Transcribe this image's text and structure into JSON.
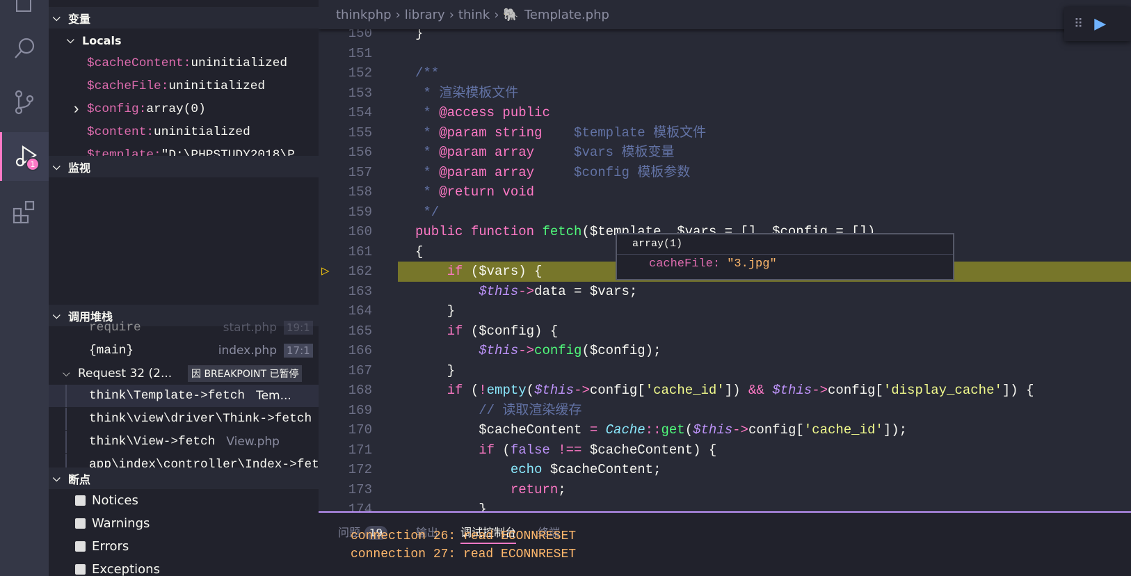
{
  "activity_bar": {
    "items": [
      "explorer-icon",
      "search-icon",
      "source-control-icon",
      "run-debug-icon",
      "extensions-icon"
    ],
    "debug_badge": "1"
  },
  "sidebar": {
    "variables": {
      "title": "变量",
      "locals_label": "Locals",
      "items": [
        {
          "name": "$cacheContent:",
          "value": "uninitialized",
          "expandable": false
        },
        {
          "name": "$cacheFile:",
          "value": "uninitialized",
          "expandable": false
        },
        {
          "name": "$config:",
          "value": "array(0)",
          "expandable": true
        },
        {
          "name": "$content:",
          "value": "uninitialized",
          "expandable": false
        },
        {
          "name": "$template:",
          "value": "\"D:\\PHPSTUDY2018\\P",
          "expandable": false
        }
      ]
    },
    "watch": {
      "title": "监视"
    },
    "call_stack": {
      "title": "调用堆栈",
      "frames_top": [
        {
          "name": "require",
          "file": "start.php",
          "pos": "19:1"
        },
        {
          "name": "{main}",
          "file": "index.php",
          "pos": "17:1"
        }
      ],
      "request": {
        "label": "Request 32 (2...",
        "status": "因 BREAKPOINT 已暂停"
      },
      "frames": [
        {
          "name": "think\\Template->fetch",
          "file": "Tem..."
        },
        {
          "name": "think\\view\\driver\\Think->fetch",
          "file": ""
        },
        {
          "name": "think\\View->fetch",
          "file": "View.php"
        },
        {
          "name": "app\\index\\controller\\Index->fet",
          "file": ""
        }
      ]
    },
    "breakpoints": {
      "title": "断点",
      "items": [
        {
          "label": "Notices",
          "checked": false
        },
        {
          "label": "Warnings",
          "checked": false
        },
        {
          "label": "Errors",
          "checked": false
        },
        {
          "label": "Exceptions",
          "checked": false
        }
      ]
    }
  },
  "editor": {
    "breadcrumb": [
      "thinkphp",
      "library",
      "think",
      "Template.php"
    ],
    "current_line": 162,
    "lines": [
      {
        "n": "150",
        "t": [
          [
            "tx",
            "}"
          ]
        ]
      },
      {
        "n": "151",
        "t": []
      },
      {
        "n": "152",
        "t": [
          [
            "cm",
            "/**"
          ]
        ]
      },
      {
        "n": "153",
        "t": [
          [
            "cm",
            " * 渲染模板文件"
          ]
        ]
      },
      {
        "n": "154",
        "t": [
          [
            "cm",
            " * "
          ],
          [
            "tag",
            "@access public"
          ]
        ]
      },
      {
        "n": "155",
        "t": [
          [
            "cm",
            " * "
          ],
          [
            "tag",
            "@param string"
          ],
          [
            "cm",
            "    $template 模板文件"
          ]
        ]
      },
      {
        "n": "156",
        "t": [
          [
            "cm",
            " * "
          ],
          [
            "tag",
            "@param array"
          ],
          [
            "cm",
            "     $vars 模板变量"
          ]
        ]
      },
      {
        "n": "157",
        "t": [
          [
            "cm",
            " * "
          ],
          [
            "tag",
            "@param array"
          ],
          [
            "cm",
            "     $config 模板参数"
          ]
        ]
      },
      {
        "n": "158",
        "t": [
          [
            "cm",
            " * "
          ],
          [
            "tag",
            "@return void"
          ]
        ]
      },
      {
        "n": "159",
        "t": [
          [
            "cm",
            " */"
          ]
        ]
      },
      {
        "n": "160",
        "t": [
          [
            "kw",
            "public function "
          ],
          [
            "fn",
            "fetch"
          ],
          [
            "tx",
            "($template, $vars = [], $config = [])"
          ]
        ]
      },
      {
        "n": "161",
        "t": [
          [
            "tx",
            "{"
          ]
        ]
      },
      {
        "n": "162",
        "t": [
          [
            "kw",
            "    if "
          ],
          [
            "tx",
            "($vars) {"
          ]
        ]
      },
      {
        "n": "163",
        "t": [
          [
            "th",
            "        $this"
          ],
          [
            "op",
            "->"
          ],
          [
            "tx",
            "data = $vars;"
          ]
        ]
      },
      {
        "n": "164",
        "t": [
          [
            "tx",
            "    }"
          ]
        ]
      },
      {
        "n": "165",
        "t": [
          [
            "kw",
            "    if "
          ],
          [
            "tx",
            "($config) {"
          ]
        ]
      },
      {
        "n": "166",
        "t": [
          [
            "th",
            "        $this"
          ],
          [
            "op",
            "->"
          ],
          [
            "fn",
            "config"
          ],
          [
            "tx",
            "($config);"
          ]
        ]
      },
      {
        "n": "167",
        "t": [
          [
            "tx",
            "    }"
          ]
        ]
      },
      {
        "n": "168",
        "t": [
          [
            "kw",
            "    if "
          ],
          [
            "tx",
            "("
          ],
          [
            "op",
            "!"
          ],
          [
            "cy",
            "empty"
          ],
          [
            "tx",
            "("
          ],
          [
            "th",
            "$this"
          ],
          [
            "op",
            "->"
          ],
          [
            "tx",
            "config["
          ],
          [
            "st",
            "'cache_id'"
          ],
          [
            "tx",
            "]) "
          ],
          [
            "op",
            "&&"
          ],
          [
            "tx",
            " "
          ],
          [
            "th",
            "$this"
          ],
          [
            "op",
            "->"
          ],
          [
            "tx",
            "config["
          ],
          [
            "st",
            "'display_cache'"
          ],
          [
            "tx",
            "]) {"
          ]
        ]
      },
      {
        "n": "169",
        "t": [
          [
            "cm",
            "        // 读取渲染缓存"
          ]
        ]
      },
      {
        "n": "170",
        "t": [
          [
            "tx",
            "        $cacheContent "
          ],
          [
            "op",
            "="
          ],
          [
            "tx",
            " "
          ],
          [
            "cls",
            "Cache"
          ],
          [
            "op",
            "::"
          ],
          [
            "fn",
            "get"
          ],
          [
            "tx",
            "("
          ],
          [
            "th",
            "$this"
          ],
          [
            "op",
            "->"
          ],
          [
            "tx",
            "config["
          ],
          [
            "st",
            "'cache_id'"
          ],
          [
            "tx",
            "]);"
          ]
        ]
      },
      {
        "n": "171",
        "t": [
          [
            "kw",
            "        if "
          ],
          [
            "tx",
            "("
          ],
          [
            "bo",
            "false"
          ],
          [
            "op",
            " !== "
          ],
          [
            "tx",
            "$cacheContent) {"
          ]
        ]
      },
      {
        "n": "172",
        "t": [
          [
            "cy",
            "            echo "
          ],
          [
            "tx",
            "$cacheContent;"
          ]
        ]
      },
      {
        "n": "173",
        "t": [
          [
            "kw",
            "            return"
          ],
          [
            "tx",
            ";"
          ]
        ]
      },
      {
        "n": "174",
        "t": [
          [
            "tx",
            "        }"
          ]
        ]
      }
    ],
    "hover": {
      "header": "array(1)",
      "key": "cacheFile:",
      "value": "\"3.jpg\""
    }
  },
  "panel": {
    "tabs": [
      {
        "label": "问题",
        "count": "19"
      },
      {
        "label": "输出"
      },
      {
        "label": "调试控制台",
        "active": true
      },
      {
        "label": "终端"
      }
    ],
    "console": [
      "connection 26: read ECONNRESET",
      "connection 27: read ECONNRESET"
    ]
  },
  "colors": {
    "accent": "#ff79c6",
    "current_line": "#77762a",
    "panel_border": "#bd93f9"
  }
}
